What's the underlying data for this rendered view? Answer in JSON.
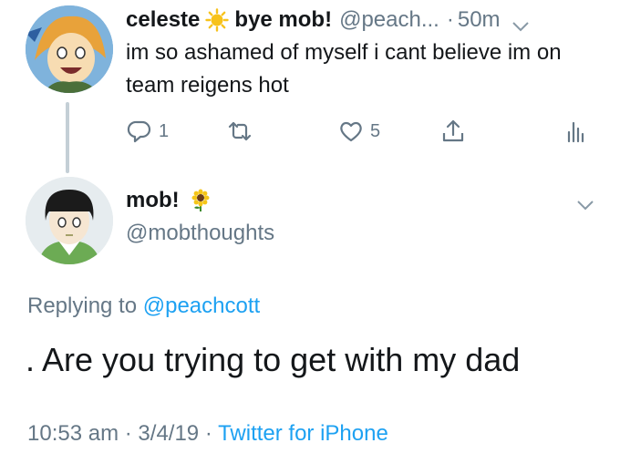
{
  "tweet1": {
    "display_name": "celeste",
    "name_suffix": "bye mob!",
    "handle": "@peach...",
    "dot": "·",
    "time": "50m",
    "text": "im so ashamed of myself i cant believe im on team reigens hot",
    "actions": {
      "reply_count": "1",
      "retweet_count": "",
      "like_count": "5"
    },
    "icons": [
      "sun-emoji-icon",
      "chevron-down-icon",
      "reply-icon",
      "retweet-icon",
      "heart-icon",
      "share-icon",
      "analytics-icon"
    ]
  },
  "tweet2": {
    "display_name": "mob!",
    "handle": "@mobthoughts",
    "replying_prefix": "Replying to",
    "replying_to": "@peachcott",
    "text": ". Are you trying to get with my dad",
    "time": "10:53 am",
    "sep1": "·",
    "date": "3/4/19",
    "sep2": "·",
    "source": "Twitter for iPhone",
    "icons": [
      "sunflower-emoji-icon",
      "chevron-down-icon"
    ]
  },
  "colors": {
    "text": "#14171a",
    "muted": "#657786",
    "link": "#1da1f2",
    "thread_line": "#c4cfd6",
    "sun": "#f7c21b"
  }
}
